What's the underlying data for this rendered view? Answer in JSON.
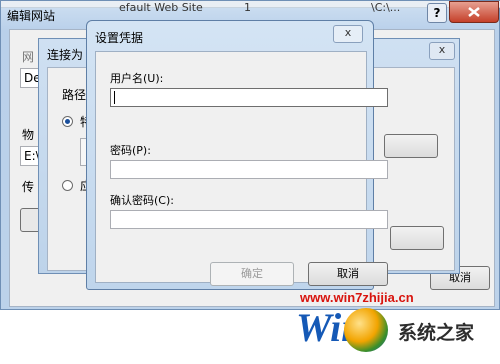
{
  "window_edit_site": {
    "title": "编辑网站",
    "help_glyph": "?",
    "truncated_top": [
      "efault Web Site",
      "1",
      "\\C:\\..."
    ],
    "alias_label_partial": "网",
    "field1_partial": "De",
    "physical_path_label_partial": "物",
    "physical_path_value_partial": "E:\\",
    "pass_label_partial": "传",
    "cancel_label_partial": "取消"
  },
  "window_connect_as": {
    "title": "连接为",
    "path_label_partial": "路径",
    "radio1_partial": "特",
    "radio2_partial": "应"
  },
  "window_set_credentials": {
    "title": "设置凭据",
    "username_label": "用户名(U):",
    "password_label": "密码(P):",
    "confirm_label": "确认密码(C):",
    "username_value": "",
    "password_value": "",
    "confirm_value": "",
    "ok_button": "确定",
    "cancel_button": "取消",
    "close_glyph": "x"
  },
  "watermark": {
    "url": "www.win7zhijia.cn",
    "brand_letters": "Win",
    "site_name": "系统之家"
  },
  "colors": {
    "title_bar": "#bfd5ec",
    "dialog_bg": "#f0f0f0",
    "watermark_red": "#d8140e",
    "watermark_blue": "#1559b6"
  }
}
